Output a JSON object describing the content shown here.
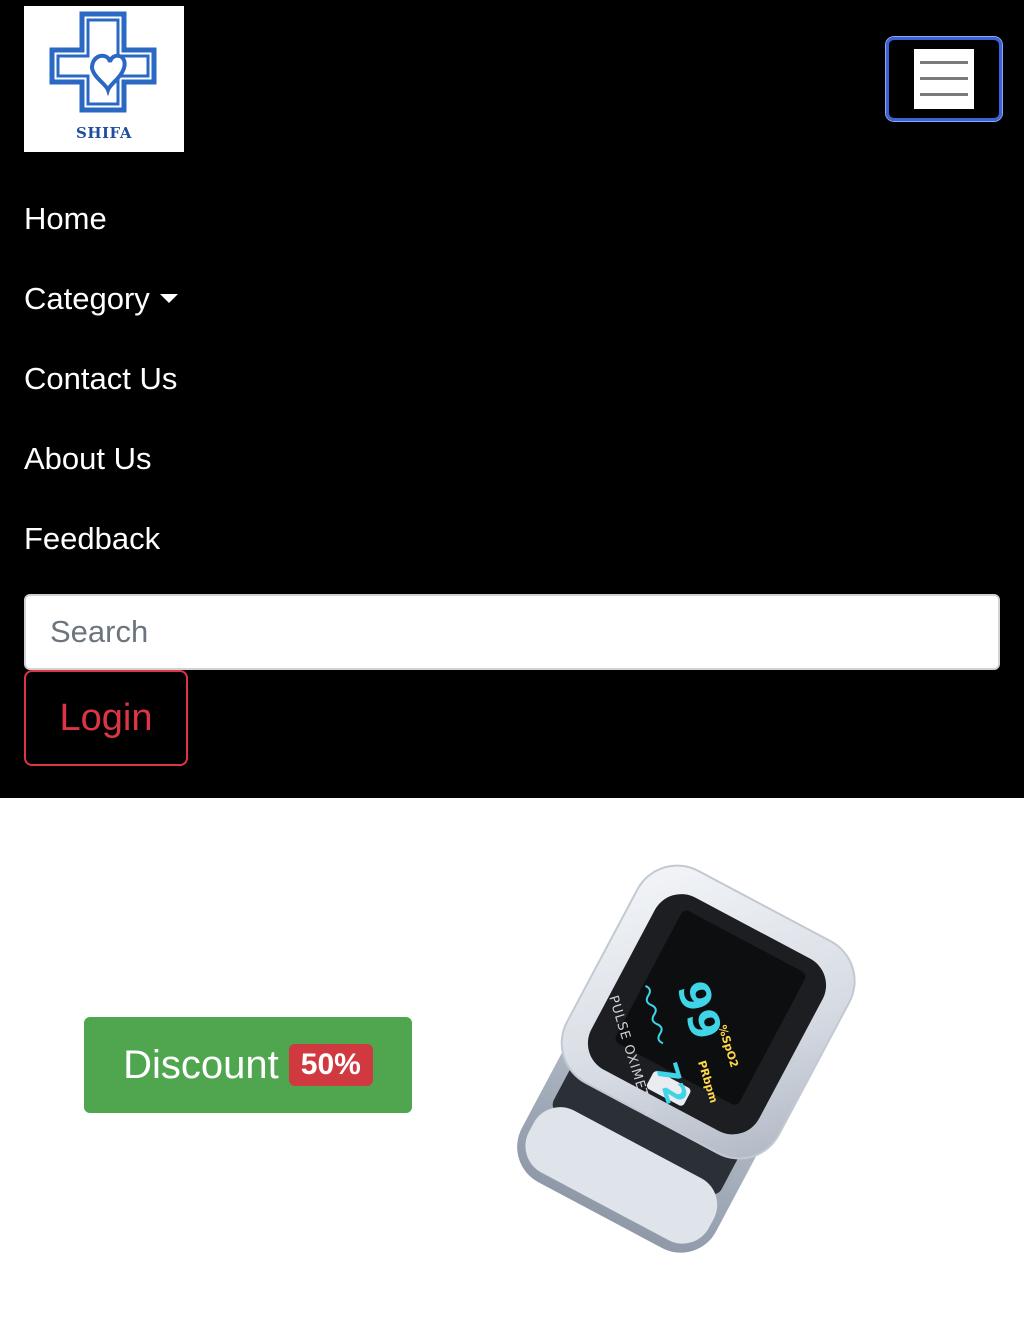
{
  "brand": {
    "logo_text": "SHIFA",
    "logo_color": "#1f4f9c"
  },
  "navbar": {
    "background": "#000000",
    "links": [
      {
        "label": "Home"
      },
      {
        "label": "Category"
      },
      {
        "label": "Contact Us"
      },
      {
        "label": "About Us"
      },
      {
        "label": "Feedback"
      }
    ],
    "search_placeholder": "Search",
    "login_label": "Login",
    "login_color": "#dc3545"
  },
  "promo": {
    "discount_label": "Discount",
    "discount_badge": "50%",
    "button_color": "#4fa64f",
    "badge_color": "#d0393f"
  },
  "product": {
    "icon": "pulse-oximeter-image",
    "screen_spo2_label": "%SpO2",
    "screen_spo2_value": "99",
    "screen_pr_label": "PRbpm",
    "screen_pr_value": "72",
    "device_label": "PULSE OXIMETER"
  }
}
